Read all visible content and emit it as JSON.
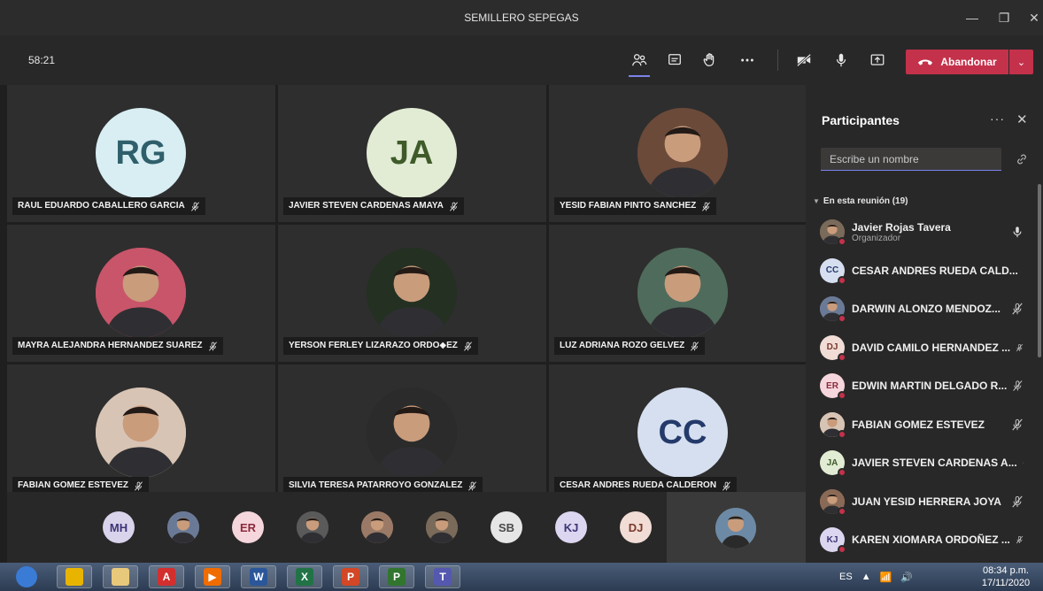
{
  "window": {
    "title": "SEMILLERO SEPEGAS",
    "minimize": "—",
    "maximize": "❐",
    "close": "✕"
  },
  "callbar": {
    "timer": "58:21",
    "leave_label": "Abandonar",
    "leave_dropdown": "⌄"
  },
  "tiles": [
    {
      "name": "RAUL EDUARDO CABALLERO GARCIA",
      "initials": "RG",
      "bg": "#d8eef3",
      "fg": "#2f5f6b",
      "photo": false
    },
    {
      "name": "JAVIER STEVEN CARDENAS AMAYA",
      "initials": "JA",
      "bg": "#e2ecd4",
      "fg": "#3f5b2a",
      "photo": false
    },
    {
      "name": "YESID FABIAN PINTO SANCHEZ",
      "initials": "",
      "bg": "#6b4a3a",
      "fg": "#fff",
      "photo": true
    },
    {
      "name": "MAYRA ALEJANDRA HERNANDEZ SUAREZ",
      "initials": "",
      "bg": "#c9556a",
      "fg": "#fff",
      "photo": true
    },
    {
      "name": "YERSON FERLEY LIZARAZO ORDO◆EZ",
      "initials": "",
      "bg": "#243022",
      "fg": "#fff",
      "photo": true
    },
    {
      "name": "LUZ ADRIANA ROZO GELVEZ",
      "initials": "",
      "bg": "#4f6b5c",
      "fg": "#fff",
      "photo": true
    },
    {
      "name": "FABIAN GOMEZ ESTEVEZ",
      "initials": "",
      "bg": "#d8c4b4",
      "fg": "#fff",
      "photo": true
    },
    {
      "name": "SILVIA TERESA PATARROYO GONZALEZ",
      "initials": "",
      "bg": "#2b2b2b",
      "fg": "#fff",
      "photo": true
    },
    {
      "name": "CESAR ANDRES RUEDA CALDERON",
      "initials": "CC",
      "bg": "#d6dff0",
      "fg": "#243a6a",
      "photo": false
    }
  ],
  "overflow": [
    {
      "initials": "MH",
      "bg": "#d9d3ec",
      "fg": "#3c3576",
      "photo": false
    },
    {
      "initials": "",
      "bg": "#6a7a96",
      "fg": "#fff",
      "photo": true
    },
    {
      "initials": "ER",
      "bg": "#f5d6dc",
      "fg": "#8a2a3c",
      "photo": false
    },
    {
      "initials": "",
      "bg": "#5a5a5a",
      "fg": "#fff",
      "photo": true
    },
    {
      "initials": "",
      "bg": "#9a7a66",
      "fg": "#fff",
      "photo": true
    },
    {
      "initials": "",
      "bg": "#7a6a5a",
      "fg": "#fff",
      "photo": true
    },
    {
      "initials": "SB",
      "bg": "#e6e6e6",
      "fg": "#4a4a4a",
      "photo": false
    },
    {
      "initials": "KJ",
      "bg": "#dcd6f0",
      "fg": "#3c3576",
      "photo": false
    },
    {
      "initials": "DJ",
      "bg": "#f1ddd6",
      "fg": "#7a3a2a",
      "photo": false
    }
  ],
  "panel": {
    "title": "Participantes",
    "more": "···",
    "close": "✕",
    "search_placeholder": "Escribe un nombre",
    "section_label": "En esta reunión (19)",
    "participants": [
      {
        "name": "Javier Rojas Tavera",
        "role": "Organizador",
        "initials": "",
        "bg": "#7a6a5a",
        "fg": "#fff",
        "mic": "on"
      },
      {
        "name": "CESAR ANDRES RUEDA CALD...",
        "role": "",
        "initials": "CC",
        "bg": "#d6dff0",
        "fg": "#243a6a",
        "mic": "off"
      },
      {
        "name": "DARWIN ALONZO MENDOZ...",
        "role": "",
        "initials": "",
        "bg": "#6a7a96",
        "fg": "#fff",
        "mic": "off"
      },
      {
        "name": "DAVID CAMILO HERNANDEZ ...",
        "role": "",
        "initials": "DJ",
        "bg": "#f1ddd6",
        "fg": "#7a3a2a",
        "mic": "off"
      },
      {
        "name": "EDWIN MARTIN DELGADO R...",
        "role": "",
        "initials": "ER",
        "bg": "#f5d6dc",
        "fg": "#8a2a3c",
        "mic": "off"
      },
      {
        "name": "FABIAN GOMEZ ESTEVEZ",
        "role": "",
        "initials": "",
        "bg": "#d8c4b4",
        "fg": "#fff",
        "mic": "off"
      },
      {
        "name": "JAVIER STEVEN CARDENAS A...",
        "role": "",
        "initials": "JA",
        "bg": "#e2ecd4",
        "fg": "#3f5b2a",
        "mic": "off"
      },
      {
        "name": "JUAN YESID HERRERA JOYA",
        "role": "",
        "initials": "",
        "bg": "#8a6a56",
        "fg": "#fff",
        "mic": "off"
      },
      {
        "name": "KAREN XIOMARA ORDOÑEZ ...",
        "role": "",
        "initials": "KJ",
        "bg": "#dcd6f0",
        "fg": "#3c3576",
        "mic": "off"
      }
    ]
  },
  "taskbar": {
    "apps": [
      {
        "label": "",
        "color": "#3a7bd5"
      },
      {
        "label": "",
        "color": "#e8b400"
      },
      {
        "label": "",
        "color": "#e8c87a"
      },
      {
        "label": "A",
        "color": "#d32f2f"
      },
      {
        "label": "▶",
        "color": "#ef6c00"
      },
      {
        "label": "W",
        "color": "#2b579a"
      },
      {
        "label": "X",
        "color": "#217346"
      },
      {
        "label": "P",
        "color": "#d24726"
      },
      {
        "label": "P",
        "color": "#31752f"
      },
      {
        "label": "T",
        "color": "#5558af"
      }
    ],
    "lang": "ES",
    "time": "08:34 p.m.",
    "date": "17/11/2020"
  }
}
